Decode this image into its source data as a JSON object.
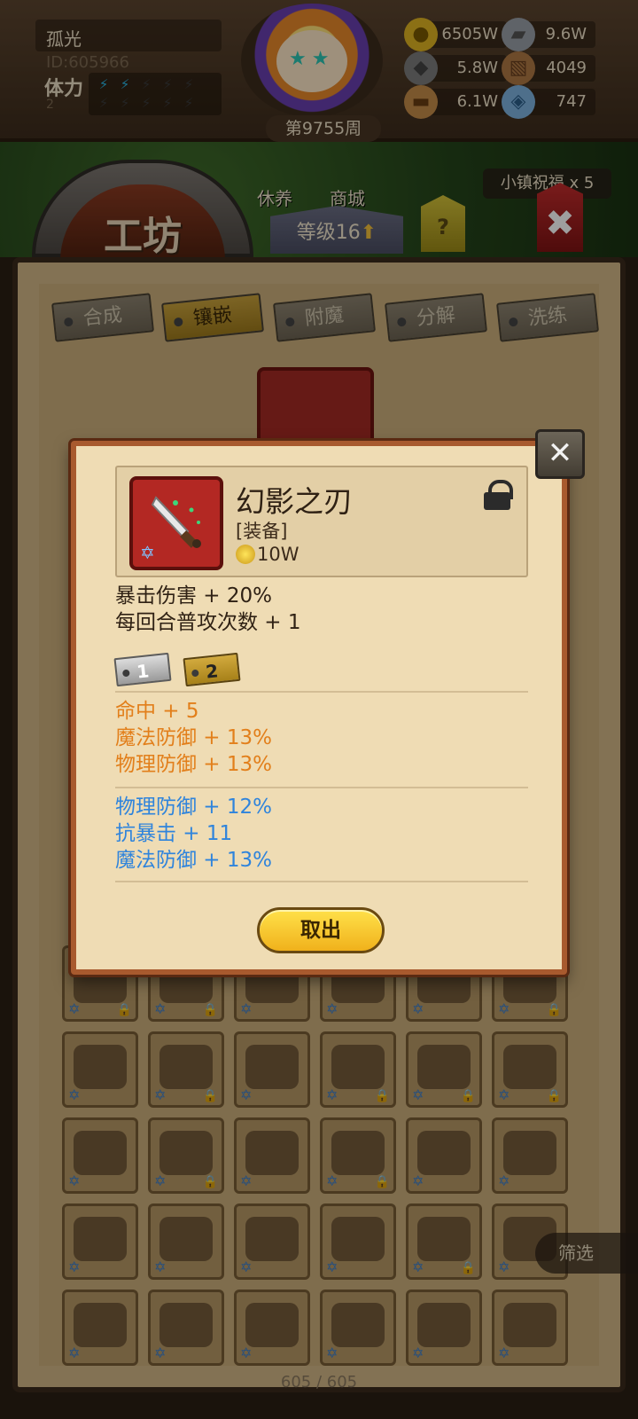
{
  "player": {
    "name": "孤光",
    "id": "ID:605966",
    "stamina_label": "体力",
    "stamina_value": "2",
    "stamina_filled": 2,
    "stamina_max": 10
  },
  "week": "第9755周",
  "resources": [
    {
      "name": "gold",
      "value": "6505W",
      "icon": "gold-coin-icon"
    },
    {
      "name": "iron",
      "value": "9.6W",
      "icon": "iron-ingot-icon"
    },
    {
      "name": "stone",
      "value": "5.8W",
      "icon": "stone-icon"
    },
    {
      "name": "leather",
      "value": "4049",
      "icon": "leather-icon"
    },
    {
      "name": "wood",
      "value": "6.1W",
      "icon": "wood-log-icon"
    },
    {
      "name": "crystal",
      "value": "747",
      "icon": "crystal-icon"
    }
  ],
  "nav": {
    "rest": "休养",
    "shop": "商城",
    "blessing": "小镇祝福 x 5",
    "level": "等级16",
    "help": "?",
    "workshop_title": "工坊"
  },
  "workshop": {
    "tabs": [
      "合成",
      "镶嵌",
      "附魔",
      "分解",
      "洗练"
    ],
    "active_tab": 1,
    "filter_label": "筛选",
    "count": "605 / 605"
  },
  "item": {
    "name": "幻影之刃",
    "type": "[装备]",
    "price": "10W",
    "locked": true,
    "base_stats": [
      "暴击伤害 + 20%",
      "每回合普攻次数 + 1"
    ],
    "gem_tabs": [
      "1",
      "2"
    ],
    "orange_stats": [
      "命中 + 5",
      "魔法防御 + 13%",
      "物理防御 + 13%"
    ],
    "blue_stats": [
      "物理防御 + 12%",
      "抗暴击 + 11",
      "魔法防御 + 13%"
    ],
    "take_out_label": "取出"
  },
  "colors": {
    "orange_stat": "#e27f1b",
    "blue_stat": "#2f84dc",
    "button": "#f0b11c"
  }
}
